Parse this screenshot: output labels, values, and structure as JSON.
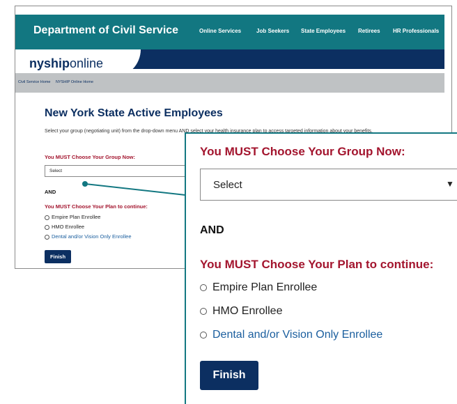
{
  "header": {
    "department_title": "Department of Civil Service",
    "nav": [
      "Online Services",
      "Job Seekers",
      "State Employees",
      "Retirees",
      "HR Professionals"
    ]
  },
  "brand": {
    "bold": "nyship",
    "light": "online"
  },
  "breadcrumb": [
    "Civil Service Home",
    "NYSHIP Online Home"
  ],
  "page": {
    "title": "New York State Active Employees",
    "instructions": "Select your group (negotiating unit) from the drop-down menu AND select your health insurance plan to access targeted information about your benefits."
  },
  "form": {
    "group_label": "You MUST Choose Your Group Now:",
    "select_value": "Select",
    "and_label": "AND",
    "plan_label": "You MUST Choose Your Plan to continue:",
    "options": [
      "Empire Plan Enrollee",
      "HMO Enrollee",
      "Dental and/or Vision Only Enrollee"
    ],
    "finish_label": "Finish"
  },
  "colors": {
    "header_teal": "#127781",
    "navy": "#0c2f61",
    "required_red": "#a3152e",
    "link_blue": "#1a5e9e",
    "breadcrumb_gray": "#bfc2c4"
  },
  "icons": {
    "select_arrow": "chevron-down-icon",
    "radio": "radio-button-icon"
  }
}
